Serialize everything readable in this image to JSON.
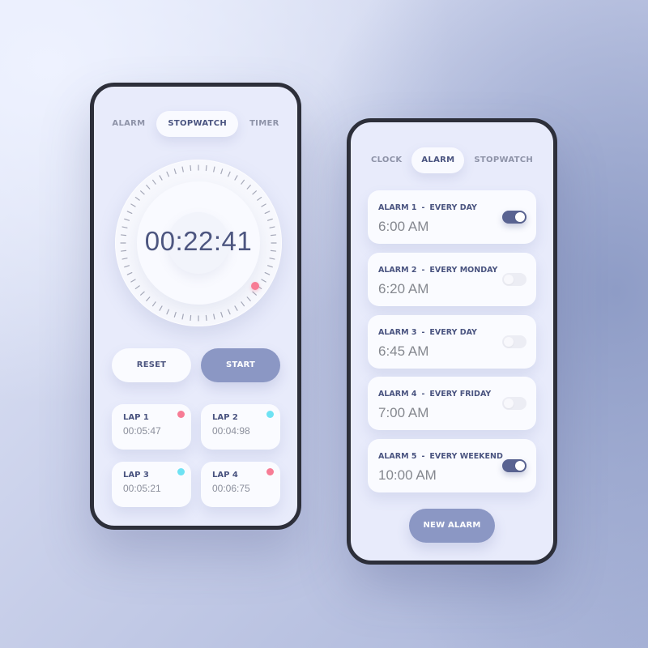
{
  "colors": {
    "accent": "#8b97c4",
    "toggle_on": "#596391",
    "text_primary": "#4a5480",
    "lap_red": "#f77c95",
    "lap_cyan": "#6ee2f3",
    "marker": "#f77c95"
  },
  "stopwatch_screen": {
    "tabs": [
      {
        "label": "ALARM",
        "active": false
      },
      {
        "label": "STOPWATCH",
        "active": true
      },
      {
        "label": "TIMER",
        "active": false
      }
    ],
    "time": "00:22:41",
    "tick_count": 60,
    "buttons": {
      "reset": "RESET",
      "start": "START"
    },
    "laps": [
      {
        "label": "LAP 1",
        "time": "00:05:47",
        "dot": "red"
      },
      {
        "label": "LAP 2",
        "time": "00:04:98",
        "dot": "cyan"
      },
      {
        "label": "LAP 3",
        "time": "00:05:21",
        "dot": "cyan"
      },
      {
        "label": "LAP 4",
        "time": "00:06:75",
        "dot": "red"
      }
    ]
  },
  "alarm_screen": {
    "tabs": [
      {
        "label": "CLOCK",
        "active": false
      },
      {
        "label": "ALARM",
        "active": true
      },
      {
        "label": "STOPWATCH",
        "active": false
      }
    ],
    "separator": "-",
    "alarms": [
      {
        "name": "ALARM 1",
        "repeat": "EVERY DAY",
        "time": "6:00 AM",
        "enabled": true
      },
      {
        "name": "ALARM 2",
        "repeat": "EVERY MONDAY",
        "time": "6:20 AM",
        "enabled": false
      },
      {
        "name": "ALARM 3",
        "repeat": "EVERY DAY",
        "time": "6:45 AM",
        "enabled": false
      },
      {
        "name": "ALARM 4",
        "repeat": "EVERY FRIDAY",
        "time": "7:00 AM",
        "enabled": false
      },
      {
        "name": "ALARM 5",
        "repeat": "EVERY WEEKEND",
        "time": "10:00 AM",
        "enabled": true
      }
    ],
    "new_alarm_label": "NEW ALARM"
  }
}
